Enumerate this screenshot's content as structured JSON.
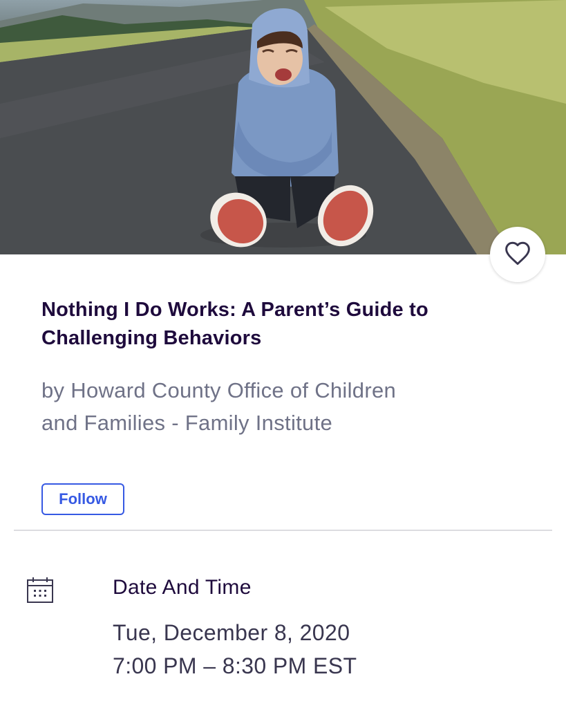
{
  "event": {
    "hero_alt": "Child in a blue hooded jacket crying while sitting on a road",
    "title": "Nothing I Do Works: A Parent’s Guide to Challenging Behaviors",
    "organizer": "by Howard County Office of Children and Families - Family Institute",
    "follow_label": "Follow",
    "favorite_icon": "heart-outline-icon"
  },
  "date_time": {
    "heading": "Date And Time",
    "icon": "calendar-icon",
    "date": "Tue, December 8, 2020",
    "time": "7:00 PM – 8:30 PM EST"
  },
  "colors": {
    "title": "#1e0a3c",
    "organizer": "#6f7287",
    "follow_accent": "#3659e3",
    "divider": "#dcdce0"
  }
}
